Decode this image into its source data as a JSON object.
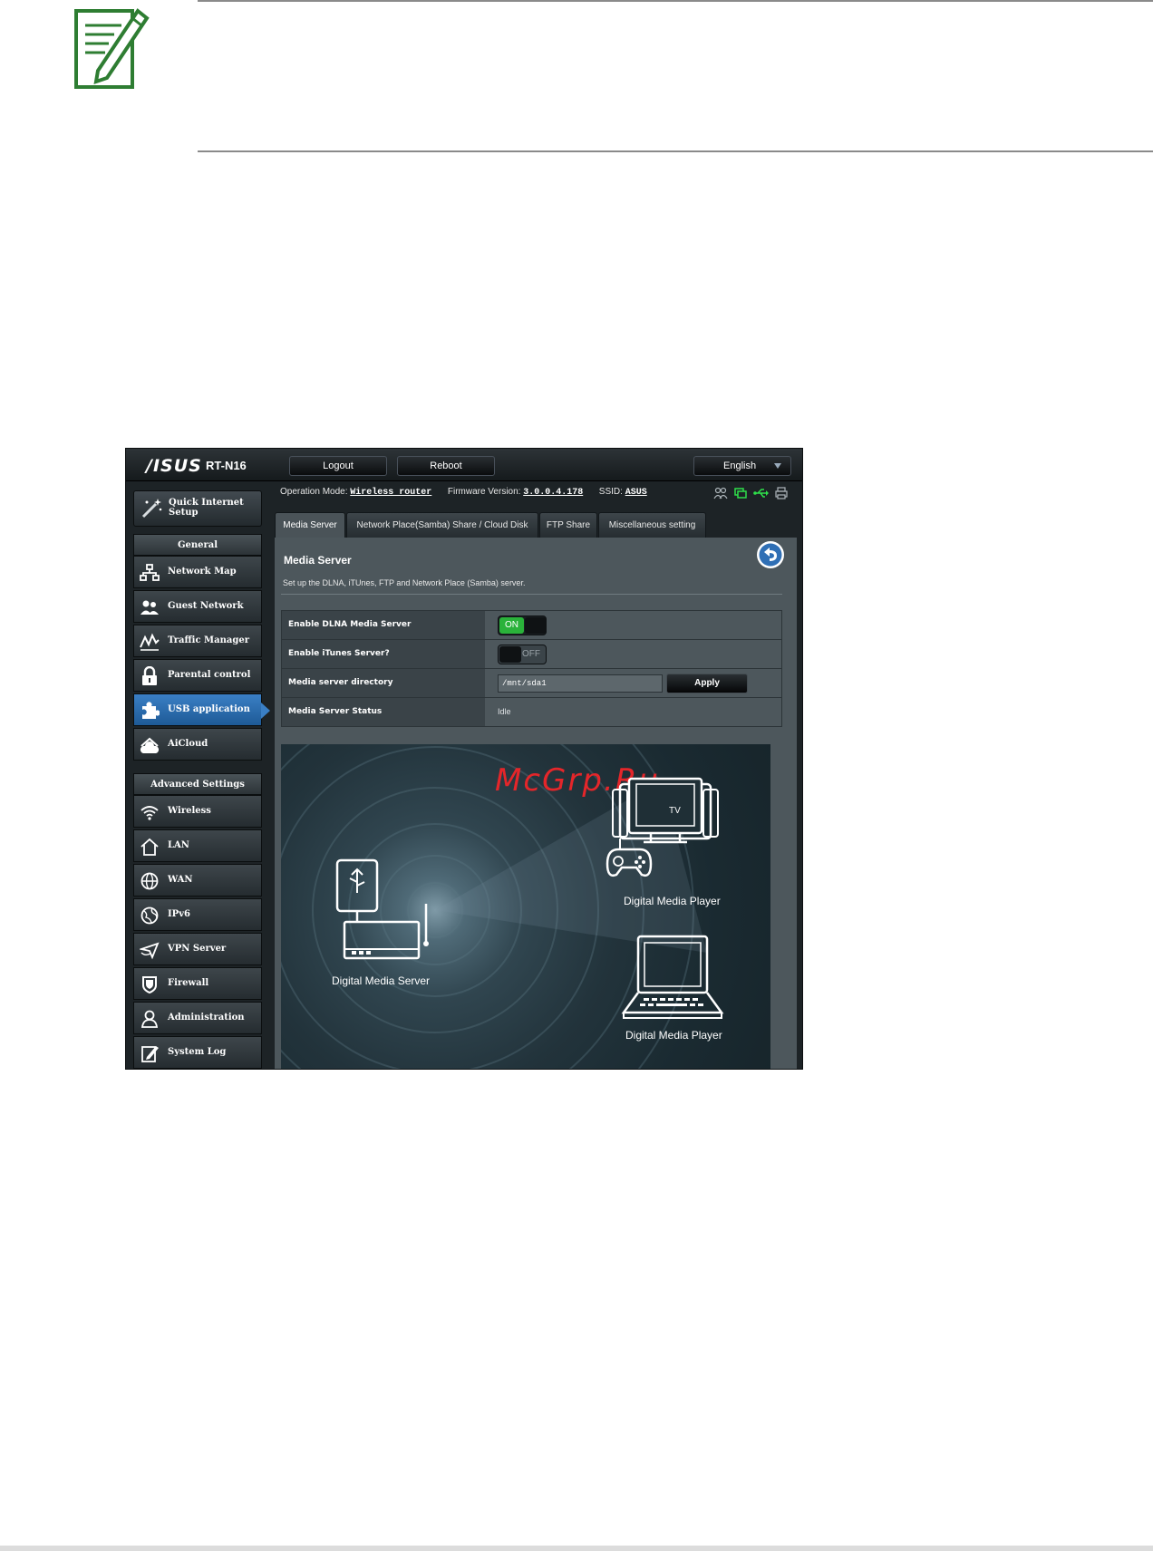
{
  "page": {
    "note_icon": "note-pencil-icon"
  },
  "app": {
    "logo": "/ISUS",
    "model": "RT-N16",
    "buttons": {
      "logout": "Logout",
      "reboot": "Reboot"
    },
    "language": "English"
  },
  "status_bar": {
    "operation_mode_label": "Operation Mode:",
    "operation_mode_value": "Wireless router",
    "firmware_label": "Firmware Version:",
    "firmware_value": "3.0.0.4.178",
    "ssid_label": "SSID:",
    "ssid_value": "ASUS",
    "icons": [
      "clients-icon",
      "internet-status-icon",
      "usb-icon",
      "printer-icon"
    ]
  },
  "sidebar": {
    "quick_setup": "Quick Internet Setup",
    "general_header": "General",
    "general_items": [
      {
        "label": "Network Map",
        "icon": "network-map-icon"
      },
      {
        "label": "Guest Network",
        "icon": "guest-network-icon"
      },
      {
        "label": "Traffic Manager",
        "icon": "traffic-manager-icon"
      },
      {
        "label": "Parental control",
        "icon": "lock-icon"
      },
      {
        "label": "USB application",
        "icon": "puzzle-icon",
        "active": true
      },
      {
        "label": "AiCloud",
        "icon": "cloud-icon"
      }
    ],
    "advanced_header": "Advanced Settings",
    "advanced_items": [
      {
        "label": "Wireless",
        "icon": "wifi-icon"
      },
      {
        "label": "LAN",
        "icon": "home-icon"
      },
      {
        "label": "WAN",
        "icon": "globe-icon"
      },
      {
        "label": "IPv6",
        "icon": "globe-v6-icon"
      },
      {
        "label": "VPN Server",
        "icon": "vpn-icon"
      },
      {
        "label": "Firewall",
        "icon": "shield-icon"
      },
      {
        "label": "Administration",
        "icon": "user-icon"
      },
      {
        "label": "System Log",
        "icon": "log-icon"
      }
    ]
  },
  "tabs": [
    {
      "label": "Media Server",
      "active": true
    },
    {
      "label": "Network Place(Samba) Share / Cloud Disk"
    },
    {
      "label": "FTP Share"
    },
    {
      "label": "Miscellaneous setting"
    }
  ],
  "panel": {
    "title": "Media Server",
    "description": "Set up the DLNA, iTUnes, FTP and Network Place (Samba) server.",
    "rows": {
      "dlna_label": "Enable DLNA Media Server",
      "dlna_state": "ON",
      "itunes_label": "Enable iTunes Server?",
      "itunes_state": "OFF",
      "dir_label": "Media server directory",
      "dir_value": "/mnt/sda1",
      "apply": "Apply",
      "status_label": "Media Server Status",
      "status_value": "Idle"
    },
    "illustration": {
      "server_caption": "Digital  Media Server",
      "player1_caption": "Digital  Media Player",
      "player2_caption": "Digital  Media Player",
      "tv_label": "TV",
      "watermark": "McGrp.Ru"
    }
  }
}
